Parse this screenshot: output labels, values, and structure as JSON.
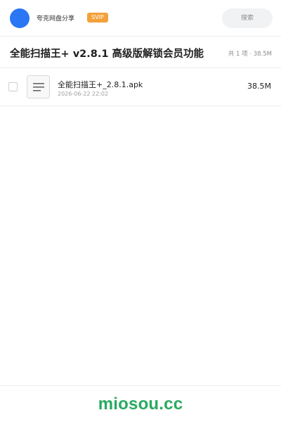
{
  "header": {
    "user_name": "夸克网盘分享",
    "badge": "SVIP",
    "search_placeholder": "搜索"
  },
  "share": {
    "title": "全能扫描王+ v2.8.1 高级版解锁会员功能",
    "summary": "共 1 项 · 38.5M"
  },
  "files": [
    {
      "name": "全能扫描王+_2.8.1.apk",
      "date": "2026-06-22 22:02",
      "size": "38.5M",
      "icon": "document-icon"
    }
  ],
  "footer": {
    "brand": "miosou.cc"
  },
  "colors": {
    "avatar": "#2a76f5",
    "badge": "#f3a13b",
    "brand": "#29a95f"
  }
}
